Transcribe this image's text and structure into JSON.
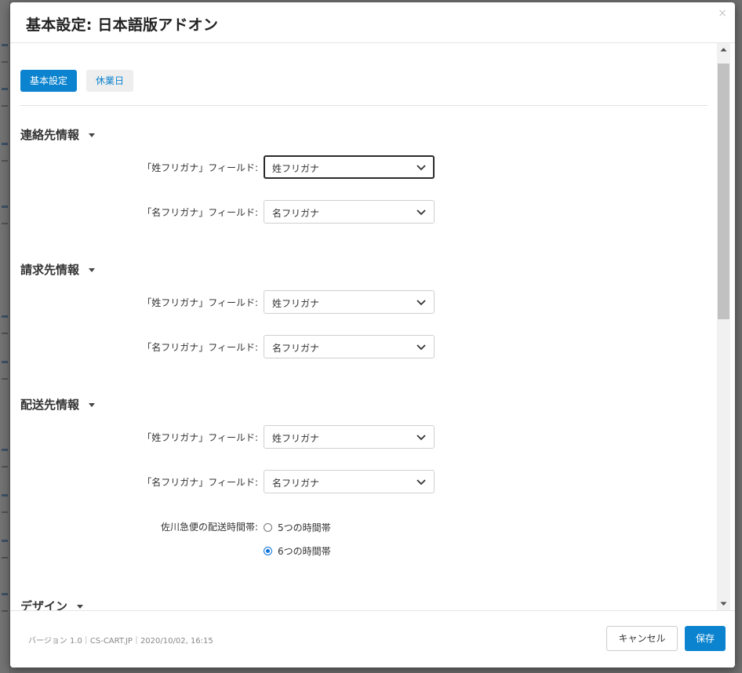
{
  "modal": {
    "title": "基本設定: 日本語版アドオン",
    "close_glyph": "×"
  },
  "tabs": [
    {
      "label": "基本設定",
      "active": true
    },
    {
      "label": "休業日",
      "active": false
    }
  ],
  "sections": {
    "contact": {
      "title": "連絡先情報",
      "fields": [
        {
          "label": "「姓フリガナ」フィールド:",
          "value": "姓フリガナ"
        },
        {
          "label": "「名フリガナ」フィールド:",
          "value": "名フリガナ"
        }
      ]
    },
    "billing": {
      "title": "請求先情報",
      "fields": [
        {
          "label": "「姓フリガナ」フィールド:",
          "value": "姓フリガナ"
        },
        {
          "label": "「名フリガナ」フィールド:",
          "value": "名フリガナ"
        }
      ]
    },
    "shipping": {
      "title": "配送先情報",
      "fields": [
        {
          "label": "「姓フリガナ」フィールド:",
          "value": "姓フリガナ"
        },
        {
          "label": "「名フリガナ」フィールド:",
          "value": "名フリガナ"
        }
      ],
      "delivery_time": {
        "label": "佐川急便の配送時間帯:",
        "options": [
          {
            "label": "5つの時間帯",
            "checked": false
          },
          {
            "label": "6つの時間帯",
            "checked": true
          }
        ]
      }
    },
    "design": {
      "title": "デザイン"
    }
  },
  "footer": {
    "version_text": "バージョン 1.0｜CS-CART.JP｜2020/10/02, 16:15",
    "cancel_label": "キャンセル",
    "save_label": "保存"
  },
  "colors": {
    "accent": "#0b83cf",
    "radio_checked": "#0b73d8"
  },
  "icons": {
    "caret": "caret-down-icon",
    "select": "chevron-down-icon",
    "close": "close-icon"
  }
}
